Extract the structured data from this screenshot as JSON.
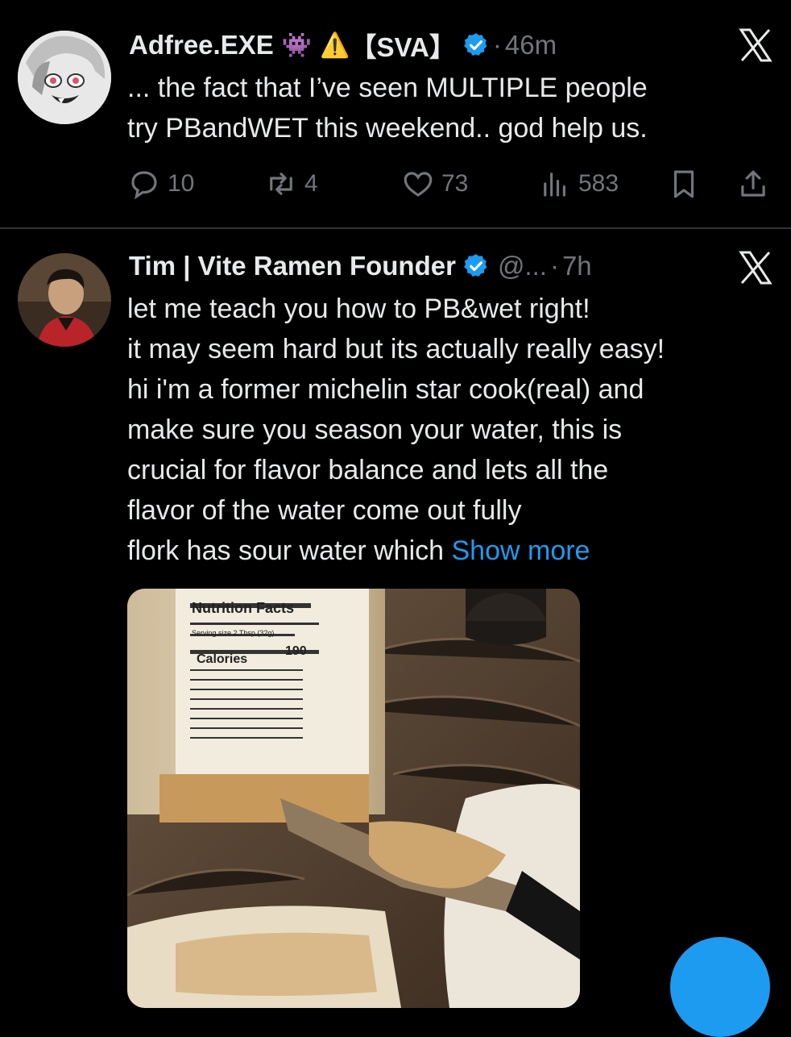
{
  "tweets": [
    {
      "display_name": "Adfree.EXE",
      "emoji_1": "👾",
      "emoji_2": "⚠️",
      "tag": "【SVA】",
      "separator": "·",
      "time": "46m",
      "text_lines": [
        "... the fact that I’ve seen MULTIPLE people",
        "try PBandWET this weekend.. god help us."
      ],
      "replies": "10",
      "reposts": "4",
      "likes": "73",
      "views": "583"
    },
    {
      "display_name": "Tim | Vite Ramen Founder",
      "handle": "@...",
      "separator": "·",
      "time": "7h",
      "text_lines": [
        "let me teach you how to PB&wet right!",
        "it may seem hard but its actually really easy!",
        "hi i'm a former michelin star cook(real) and",
        "make sure you season your water, this is",
        "crucial for flavor balance and lets all the",
        "flavor of the water come out fully",
        "flork has sour water which "
      ],
      "show_more": "Show more",
      "media_label": {
        "title": "Nutrition Facts",
        "serving": "Serving size 2 Tbsp (32g)",
        "calories_label": "Calories",
        "calories_value": "190"
      }
    }
  ],
  "colors": {
    "background": "#000000",
    "text": "#e7e9ea",
    "muted": "#71767b",
    "accent": "#1d9bf0"
  },
  "icons": {
    "verified": "verified-badge-icon",
    "close": "x-close-icon",
    "reply": "reply-icon",
    "repost": "repost-icon",
    "like": "like-icon",
    "views": "views-icon",
    "bookmark": "bookmark-icon",
    "share": "share-icon"
  }
}
